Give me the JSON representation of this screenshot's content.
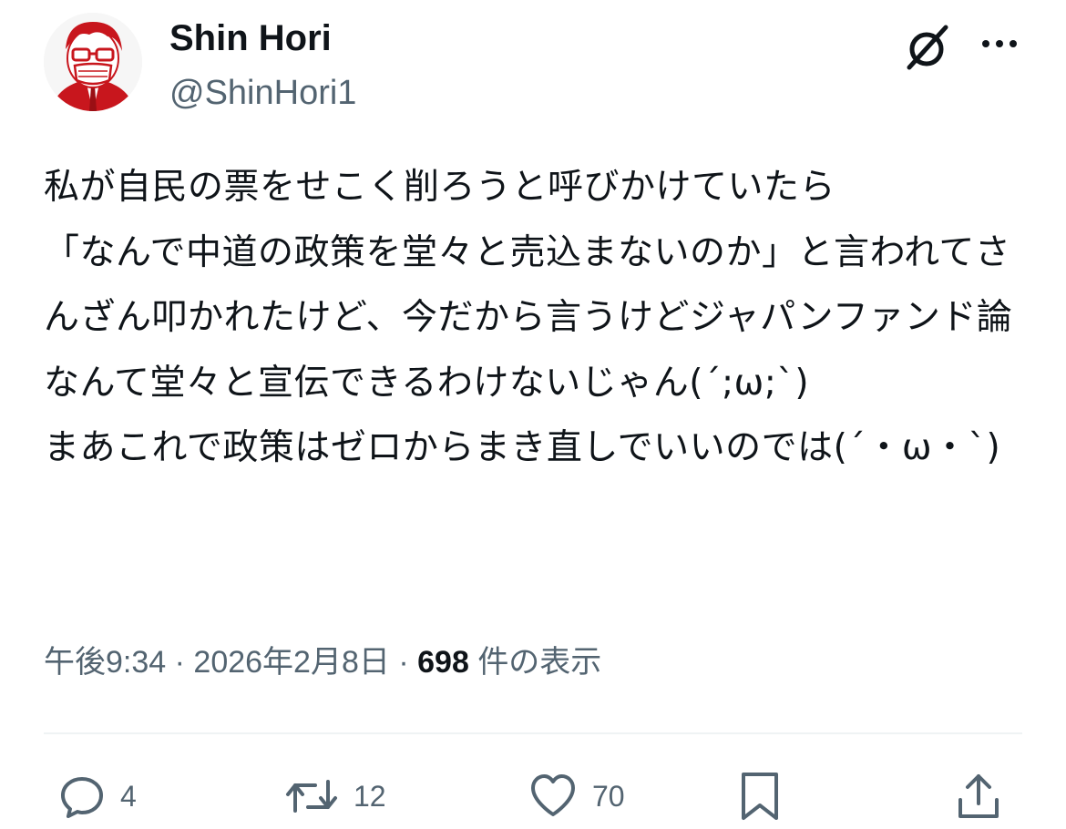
{
  "tweet": {
    "display_name": "Shin Hori",
    "handle": "@ShinHori1",
    "text": "私が自民の票をせこく削ろうと呼びかけていたら\n「なんで中道の政策を堂々と売込まないのか」と言われてさんざん叩かれたけど、今だから言うけどジャパンファンド論なんて堂々と宣伝できるわけないじゃん(´;ω;`)\nまあこれで政策はゼロからまき直しでいいのでは(´・ω・`)",
    "time": "午後9:34",
    "date": "2026年2月8日",
    "separator": "·",
    "views_count": "698",
    "views_label": "件の表示"
  },
  "actions": {
    "reply_count": "4",
    "retweet_count": "12",
    "like_count": "70"
  },
  "icons": {
    "grok": "grok-icon",
    "more": "more-icon",
    "reply": "reply-icon",
    "retweet": "retweet-icon",
    "like": "heart-icon",
    "bookmark": "bookmark-icon",
    "share": "share-icon"
  },
  "colors": {
    "text": "#0f1419",
    "secondary": "#536471",
    "divider": "#eff3f4",
    "avatar_accent": "#c8161d"
  }
}
